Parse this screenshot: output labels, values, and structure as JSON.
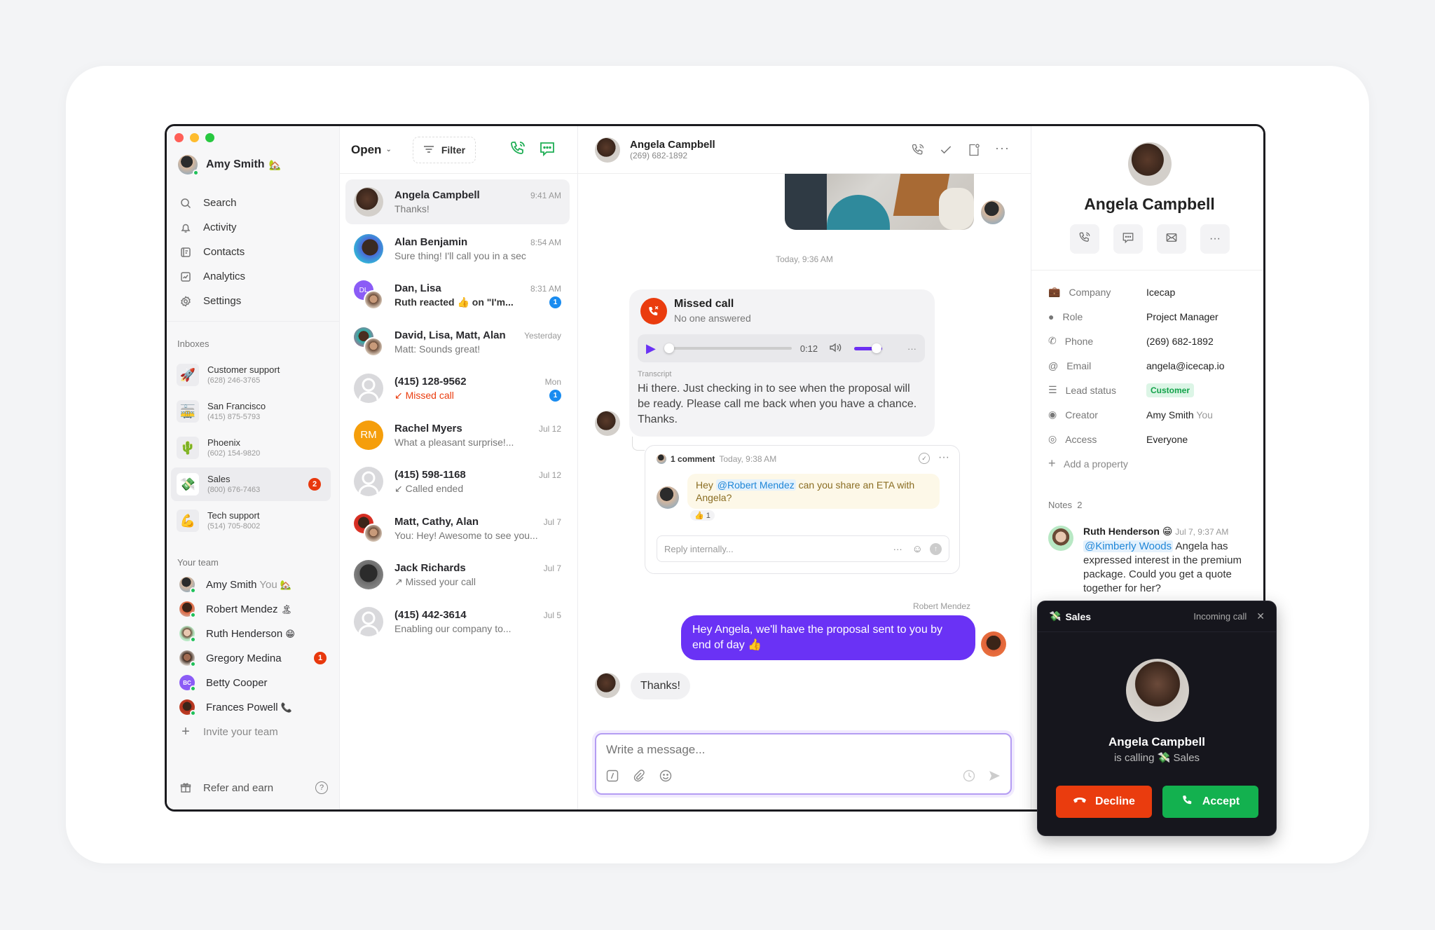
{
  "window": {
    "controls": {
      "close": "#ff5f57",
      "minimize": "#febc2e",
      "maximize": "#28c840"
    }
  },
  "sidebar": {
    "user": {
      "name": "Amy Smith",
      "status_emoji": "🏡"
    },
    "nav": [
      {
        "label": "Search",
        "icon": "search-icon"
      },
      {
        "label": "Activity",
        "icon": "bell-icon"
      },
      {
        "label": "Contacts",
        "icon": "contacts-icon"
      },
      {
        "label": "Analytics",
        "icon": "analytics-icon"
      },
      {
        "label": "Settings",
        "icon": "gear-icon"
      }
    ],
    "inboxes_label": "Inboxes",
    "inboxes": [
      {
        "name": "Customer support",
        "phone": "(628) 246-3765",
        "emoji": "🚀"
      },
      {
        "name": "San Francisco",
        "phone": "(415) 875-5793",
        "emoji": "🚋"
      },
      {
        "name": "Phoenix",
        "phone": "(602) 154-9820",
        "emoji": "🌵"
      },
      {
        "name": "Sales",
        "phone": "(800) 676-7463",
        "emoji": "💸",
        "badge": "2",
        "selected": true
      },
      {
        "name": "Tech support",
        "phone": "(514) 705-8002",
        "emoji": "💪"
      }
    ],
    "team_label": "Your team",
    "team": [
      {
        "name": "Amy Smith",
        "you": "You",
        "emoji": "🏡"
      },
      {
        "name": "Robert Mendez",
        "emoji": "🏝"
      },
      {
        "name": "Ruth Henderson",
        "emoji": "😁"
      },
      {
        "name": "Gregory Medina",
        "badge": "1"
      },
      {
        "name": "Betty Cooper",
        "initials": "BC"
      },
      {
        "name": "Frances Powell",
        "emoji": "📞"
      }
    ],
    "invite": "Invite your team",
    "refer": "Refer and earn"
  },
  "list": {
    "status": "Open",
    "filter": "Filter",
    "conversations": [
      {
        "name": "Angela Campbell",
        "time": "9:41 AM",
        "preview": "Thanks!",
        "selected": true
      },
      {
        "name": "Alan Benjamin",
        "time": "8:54 AM",
        "preview": "Sure thing! I'll call you in a sec"
      },
      {
        "name": "Dan, Lisa",
        "time": "8:31 AM",
        "preview": "Ruth reacted 👍 on \"I'm...",
        "unread": "1",
        "bold": true
      },
      {
        "name": "David, Lisa, Matt, Alan",
        "time": "Yesterday",
        "preview": "Matt: Sounds great!"
      },
      {
        "name": "(415) 128-9562",
        "time": "Mon",
        "preview": "↙ Missed call",
        "unread": "1",
        "missed": true
      },
      {
        "name": "Rachel Myers",
        "time": "Jul 12",
        "preview": "What a pleasant surprise!...",
        "initials": "RM"
      },
      {
        "name": "(415) 598-1168",
        "time": "Jul 12",
        "preview": "↙ Called ended"
      },
      {
        "name": "Matt, Cathy, Alan",
        "time": "Jul 7",
        "preview": "You: Hey! Awesome to see you..."
      },
      {
        "name": "Jack Richards",
        "time": "Jul 7",
        "preview": "↗ Missed your call"
      },
      {
        "name": "(415) 442-3614",
        "time": "Jul 5",
        "preview": "Enabling our company to..."
      }
    ]
  },
  "chat": {
    "contact": {
      "name": "Angela Campbell",
      "phone": "(269) 682-1892"
    },
    "timestamp": "Today, 9:36 AM",
    "missed_call": {
      "title": "Missed call",
      "subtitle": "No one answered",
      "duration": "0:12",
      "playback_progress": 0.0,
      "volume": 0.8,
      "transcript_label": "Transcript",
      "transcript": "Hi there. Just checking in to see when the proposal will be ready. Please call me back when you have a chance. Thanks."
    },
    "comment": {
      "count": "1 comment",
      "time": "Today, 9:38 AM",
      "text_before": "Hey ",
      "mention": "@Robert Mendez",
      "text_after": " can you share an ETA with Angela?",
      "reaction": "👍 1",
      "reply_placeholder": "Reply internally..."
    },
    "outgoing": {
      "sender": "Robert Mendez",
      "text": "Hey Angela, we'll have the proposal sent to you by end of day 👍"
    },
    "incoming": {
      "text": "Thanks!"
    },
    "composer": {
      "placeholder": "Write a message..."
    }
  },
  "profile": {
    "name": "Angela Campbell",
    "properties": [
      {
        "key": "Company",
        "value": "Icecap",
        "icon": "briefcase-icon"
      },
      {
        "key": "Role",
        "value": "Project Manager",
        "icon": "person-icon"
      },
      {
        "key": "Phone",
        "value": "(269) 682-1892",
        "icon": "phone-icon"
      },
      {
        "key": "Email",
        "value": "angela@icecap.io",
        "icon": "at-icon"
      },
      {
        "key": "Lead status",
        "value": "Customer",
        "icon": "list-icon",
        "tag": true
      },
      {
        "key": "Creator",
        "value": "Amy Smith",
        "suffix": "You",
        "icon": "user-circle-icon"
      },
      {
        "key": "Access",
        "value": "Everyone",
        "icon": "eye-icon"
      }
    ],
    "add_property": "Add a property",
    "notes_label": "Notes",
    "notes_count": "2",
    "note": {
      "author": "Ruth Henderson",
      "emoji": "😁",
      "time": "Jul 7, 9:37 AM",
      "mention": "@Kimberly Woods",
      "text": " Angela has expressed interest in the premium package. Could you get a quote together for her?"
    }
  },
  "incoming_call": {
    "inbox": "Sales",
    "inbox_emoji": "💸",
    "label": "Incoming call",
    "caller": "Angela Campbell",
    "subtitle_prefix": "is calling",
    "subtitle_inbox": "Sales",
    "decline": "Decline",
    "accept": "Accept"
  },
  "colors": {
    "accent": "#6a32f5",
    "success": "#13b14f",
    "danger": "#ea3c0e",
    "unread": "#1a8cf0"
  }
}
